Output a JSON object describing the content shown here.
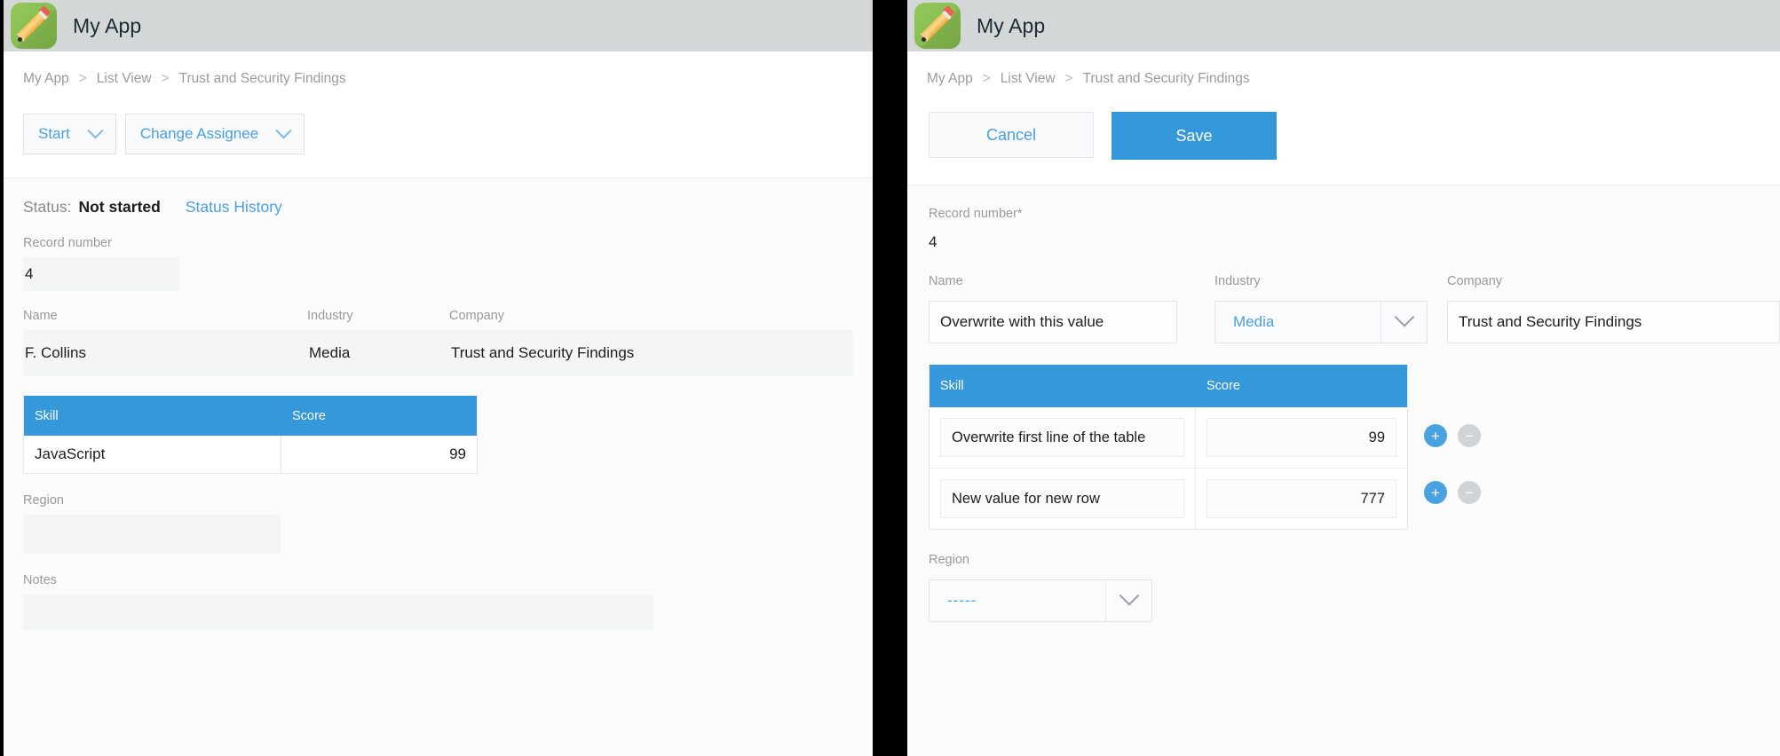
{
  "app": {
    "title": "My App",
    "logo_icon": "pencil-icon"
  },
  "breadcrumb": {
    "root": "My App",
    "sep": ">",
    "middle": "List View",
    "current": "Trust and Security Findings"
  },
  "left": {
    "toolbar": {
      "start_label": "Start",
      "change_assignee_label": "Change Assignee",
      "chevron_icon": "chevron-down-icon"
    },
    "status": {
      "label": "Status:",
      "value": "Not started",
      "history_link": "Status History"
    },
    "fields": {
      "record_number_label": "Record number",
      "record_number_value": "4",
      "name_label": "Name",
      "name_value": "F. Collins",
      "industry_label": "Industry",
      "industry_value": "Media",
      "company_label": "Company",
      "company_value": "Trust and Security Findings",
      "region_label": "Region",
      "region_value": "",
      "notes_label": "Notes",
      "notes_value": ""
    },
    "table": {
      "columns": [
        "Skill",
        "Score"
      ],
      "rows": [
        {
          "skill": "JavaScript",
          "score": "99"
        }
      ]
    }
  },
  "right": {
    "toolbar": {
      "cancel_label": "Cancel",
      "save_label": "Save"
    },
    "fields": {
      "record_number_label": "Record number*",
      "record_number_value": "4",
      "name_label": "Name",
      "name_value": "Overwrite with this value",
      "industry_label": "Industry",
      "industry_value": "Media",
      "company_label": "Company",
      "company_value": "Trust and Security Findings",
      "region_label": "Region",
      "region_value": "-----"
    },
    "table": {
      "columns": [
        "Skill",
        "Score"
      ],
      "rows": [
        {
          "skill": "Overwrite first line of the table",
          "score": "99"
        },
        {
          "skill": "New value for new row",
          "score": "777"
        }
      ],
      "add_icon": "plus-icon",
      "remove_icon": "minus-icon"
    },
    "dropdown_icon": "chevron-down-icon"
  },
  "colors": {
    "accent": "#3498db",
    "link": "#4a9fe0",
    "header_bar": "#d4d7d7",
    "logo_green": "#8cc152",
    "muted_label": "#9a9a9a",
    "readonly_field": "#f4f6f6",
    "minus_gray": "#cfd4d8"
  }
}
